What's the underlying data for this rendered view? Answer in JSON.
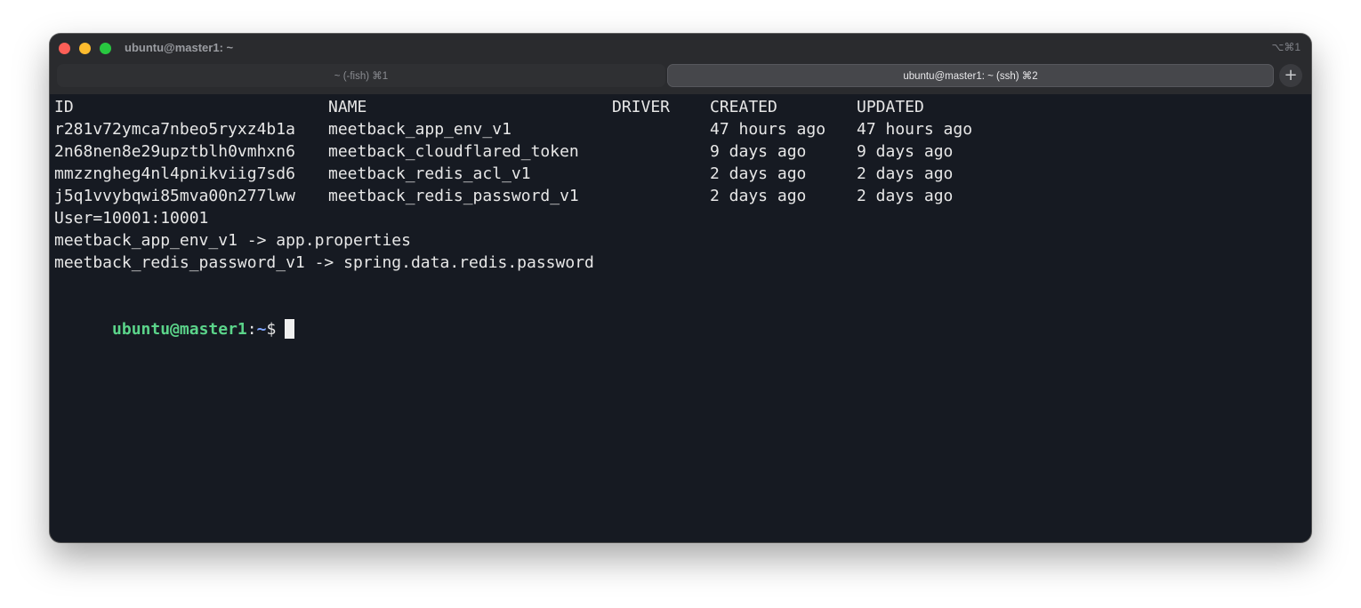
{
  "window": {
    "title": "ubuntu@master1: ~",
    "shortcut": "⌥⌘1"
  },
  "tabs": [
    {
      "label": "~ (-fish) ⌘1",
      "active": false
    },
    {
      "label": "ubuntu@master1: ~ (ssh) ⌘2",
      "active": true
    }
  ],
  "new_tab_label": "+",
  "table": {
    "headers": [
      "ID",
      "NAME",
      "DRIVER",
      "CREATED",
      "UPDATED"
    ],
    "rows": [
      {
        "id": "r281v72ymca7nbeo5ryxz4b1a",
        "name": "meetback_app_env_v1",
        "driver": "",
        "created": "47 hours ago",
        "updated": "47 hours ago"
      },
      {
        "id": "2n68nen8e29upztblh0vmhxn6",
        "name": "meetback_cloudflared_token",
        "driver": "",
        "created": "9 days ago",
        "updated": "9 days ago"
      },
      {
        "id": "mmzzngheg4nl4pnikviig7sd6",
        "name": "meetback_redis_acl_v1",
        "driver": "",
        "created": "2 days ago",
        "updated": "2 days ago"
      },
      {
        "id": "j5q1vvybqwi85mva00n277lww",
        "name": "meetback_redis_password_v1",
        "driver": "",
        "created": "2 days ago",
        "updated": "2 days ago"
      }
    ]
  },
  "output_lines": [
    "User=10001:10001",
    "meetback_app_env_v1 -> app.properties",
    "meetback_redis_password_v1 -> spring.data.redis.password"
  ],
  "prompt": {
    "user_host": "ubuntu@master1",
    "separator": ":",
    "path": "~",
    "symbol": "$"
  },
  "colors": {
    "terminal_bg": "#161a22",
    "text": "#e7e7e7",
    "prompt_user": "#5bd48a",
    "prompt_path": "#7fa5ff"
  }
}
